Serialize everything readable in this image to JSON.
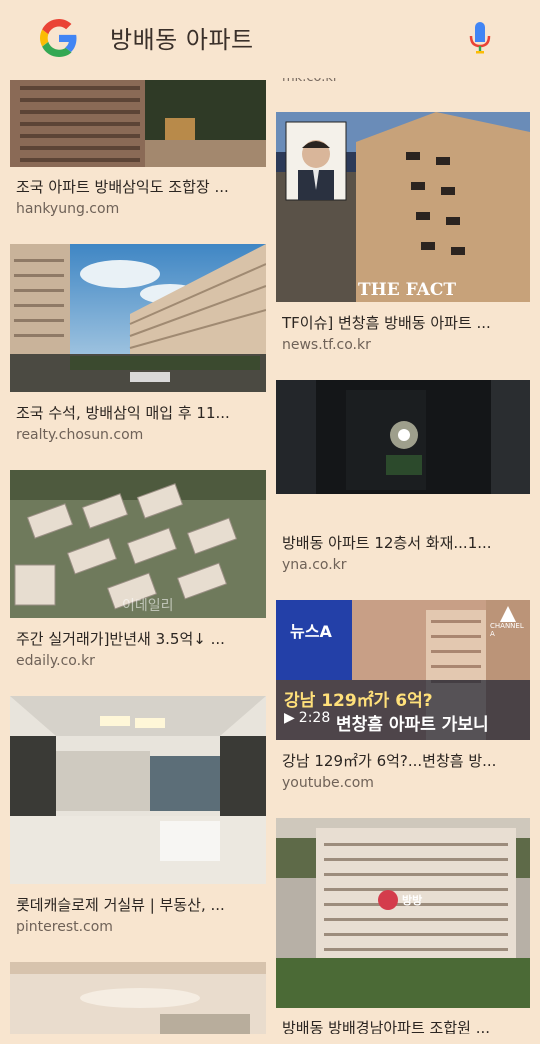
{
  "search": {
    "query": "방배동 아파트",
    "logo_icon": "google-g-logo",
    "mic_icon": "microphone-icon"
  },
  "partial_top_source": "mk.co.kr",
  "left_column": [
    {
      "title": "조국 아파트 방배삼익도 조합장 ...",
      "source": "hankyung.com",
      "thumb": "apartment-building-photo"
    },
    {
      "title": "조국 수석, 방배삼익 매입 후 11...",
      "source": "realty.chosun.com",
      "thumb": "apartment-complex-street-photo"
    },
    {
      "title": "주간 실거래가]반년새 3.5억↓ ...",
      "source": "edaily.co.kr",
      "thumb": "aerial-apartment-photo"
    },
    {
      "title": "롯데캐슬로제 거실뷰 | 부동산, ...",
      "source": "pinterest.com",
      "thumb": "living-room-photo"
    },
    {
      "title": "",
      "source": "",
      "thumb": "interior-photo"
    }
  ],
  "right_column": [
    {
      "title": "TF이슈] 변창흠 방배동 아파트 ...",
      "source": "news.tf.co.kr",
      "thumb": "the-fact-building-photo",
      "overlay": "THE FACT"
    },
    {
      "title": "방배동 아파트 12층서 화재...1...",
      "source": "yna.co.kr",
      "thumb": "dark-room-fire-photo"
    },
    {
      "title": "강남 129㎡가 6억?...변창흠 방...",
      "source": "youtube.com",
      "thumb": "news-video-thumbnail",
      "video": {
        "channel_badge": "뉴스A",
        "headline_1": "강남 129㎡가 6억?",
        "headline_2": "변창흠 아파트 가보니",
        "duration": "2:28",
        "channel": "CHANNEL A"
      }
    },
    {
      "title": "방배동 방배경남아파트 조합원 ...",
      "source": "",
      "thumb": "tall-apartment-photo",
      "watermark": "방방"
    }
  ]
}
